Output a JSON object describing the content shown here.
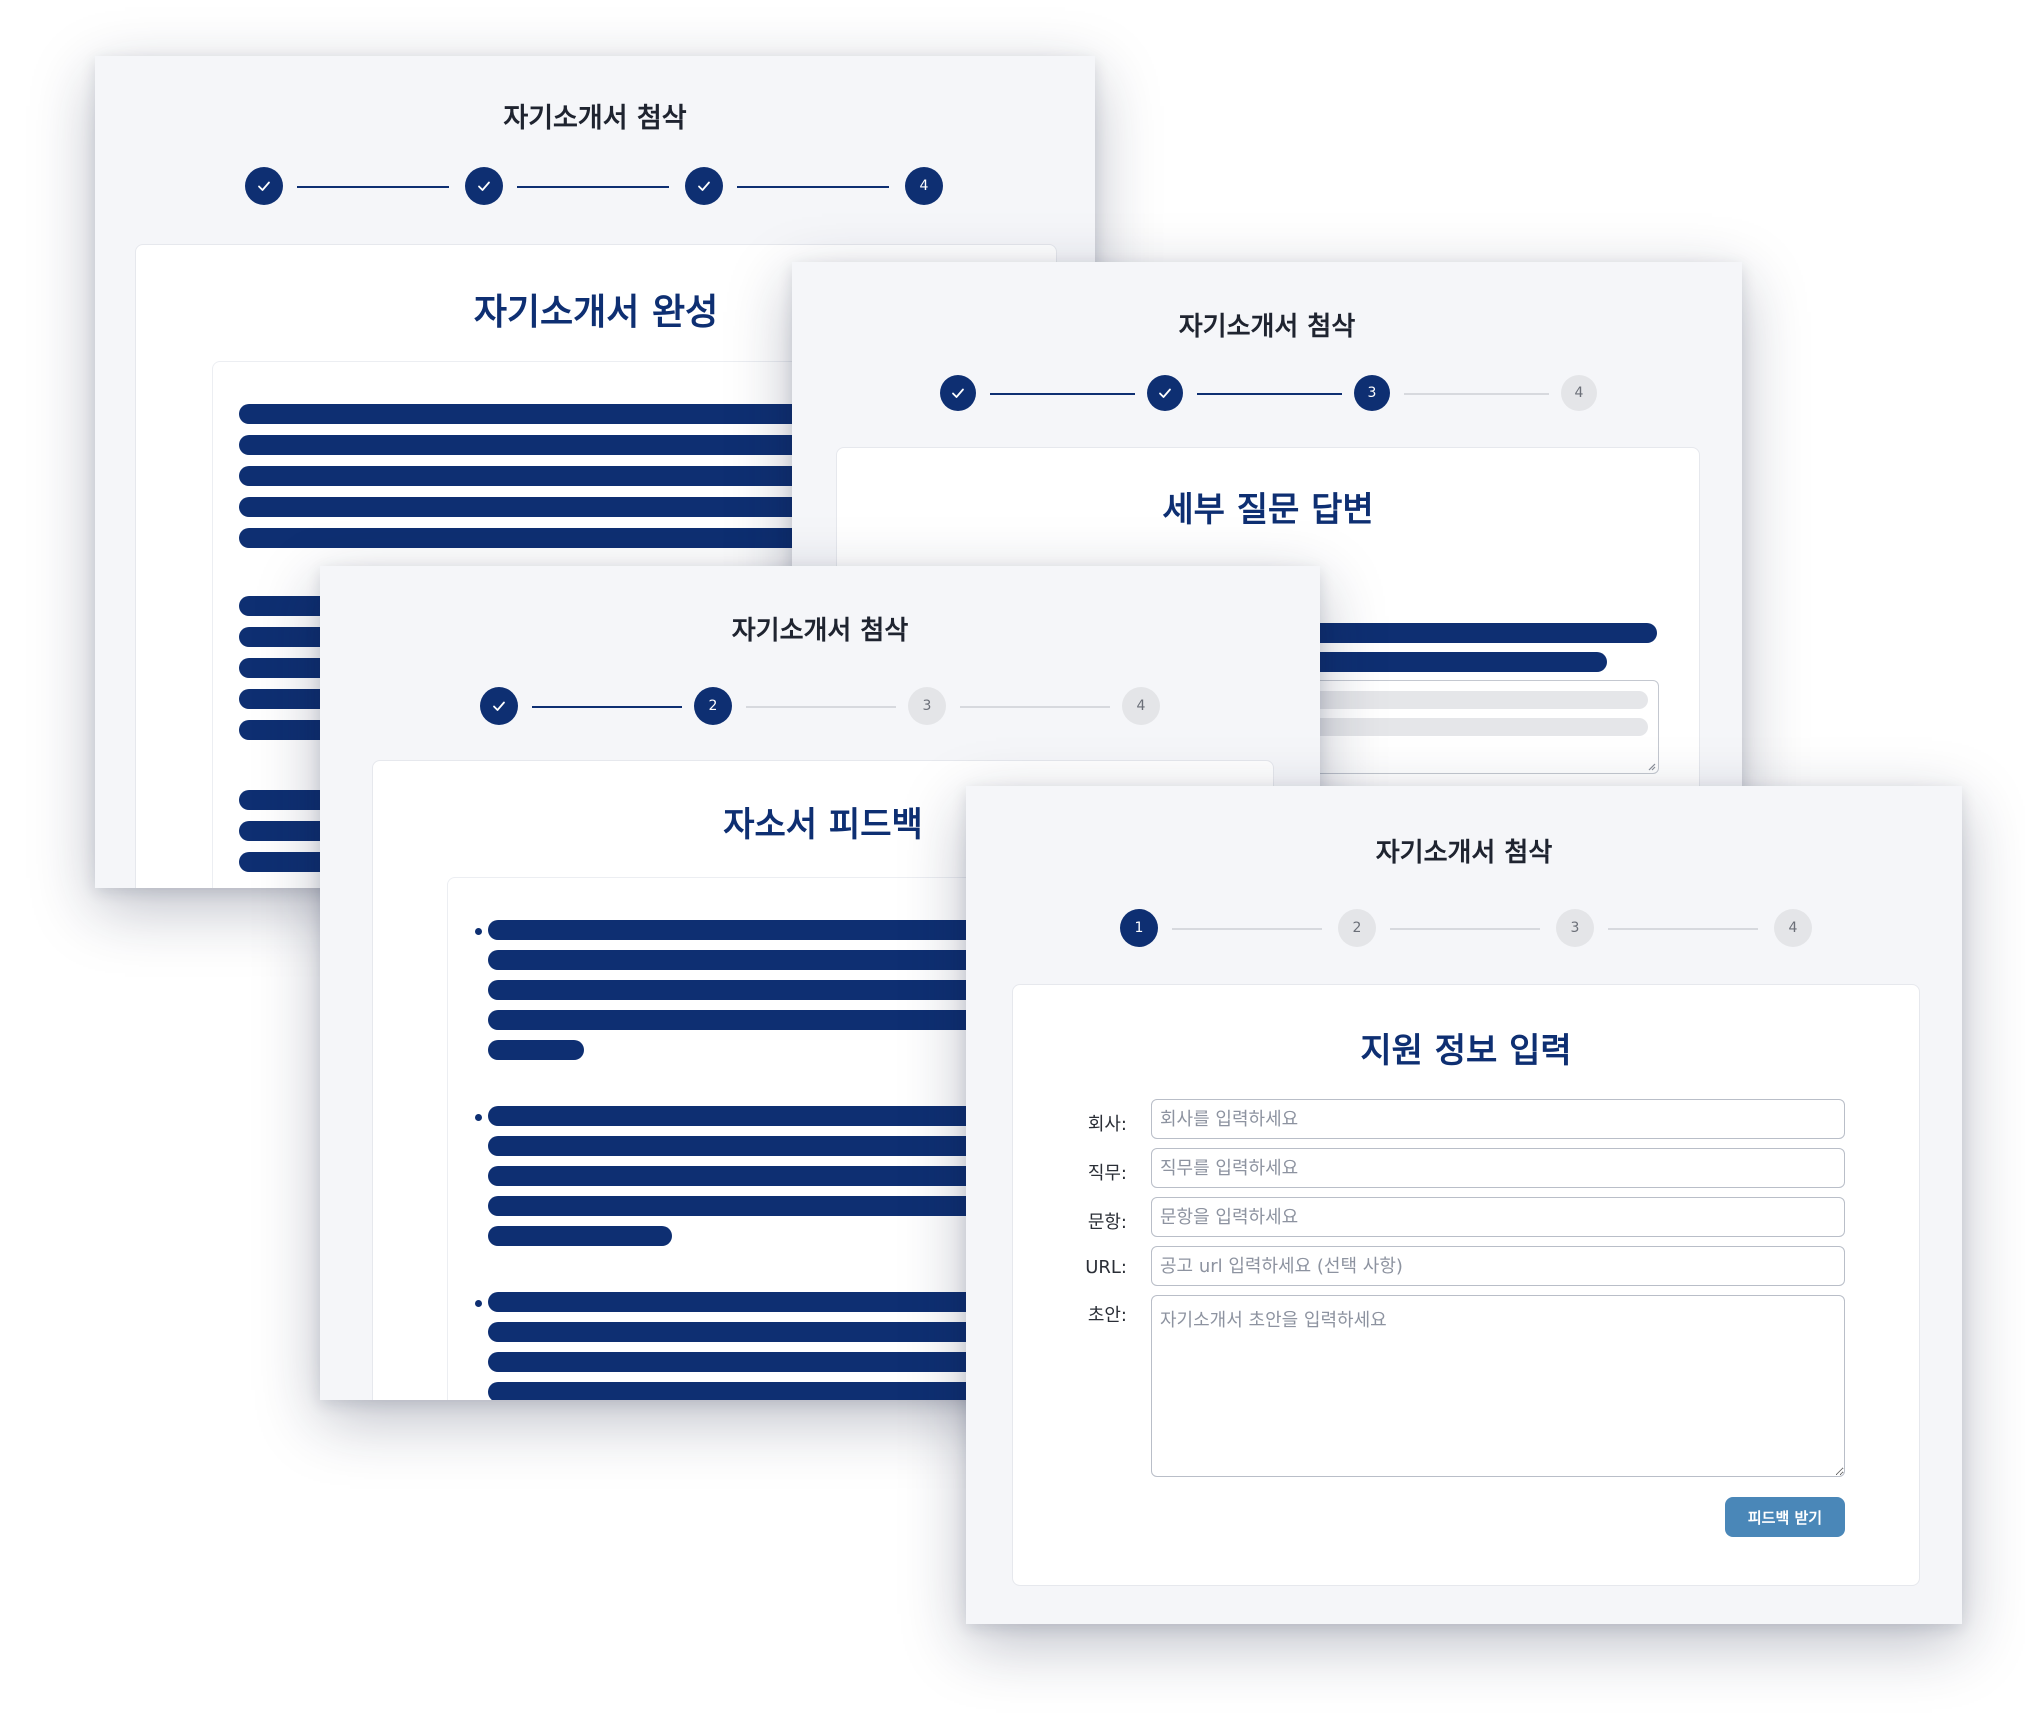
{
  "screens": [
    {
      "app_title": "자기소개서 첨삭",
      "steps": [
        "check",
        "check",
        "check",
        "4"
      ],
      "card_title": "자기소개서 완성"
    },
    {
      "app_title": "자기소개서 첨삭",
      "steps": [
        "check",
        "check",
        "3",
        "4"
      ],
      "card_title": "세부 질문 답변"
    },
    {
      "app_title": "자기소개서 첨삭",
      "steps": [
        "check",
        "2",
        "3",
        "4"
      ],
      "card_title": "자소서 피드백"
    },
    {
      "app_title": "자기소개서 첨삭",
      "steps": [
        "1",
        "2",
        "3",
        "4"
      ],
      "card_title": "지원 정보 입력",
      "form": {
        "company_label": "회사:",
        "company_placeholder": "회사를 입력하세요",
        "job_label": "직무:",
        "job_placeholder": "직무를 입력하세요",
        "question_label": "문항:",
        "question_placeholder": "문항을 입력하세요",
        "url_label": "URL:",
        "url_placeholder": "공고 url 입력하세요 (선택 사항)",
        "draft_label": "초안:",
        "draft_placeholder": "자기소개서 초안을 입력하세요",
        "submit_label": "피드백 받기"
      }
    }
  ],
  "colors": {
    "primary": "#0e2f72",
    "step_inactive": "#e4e5e8",
    "button": "#4a87b8",
    "page_bg": "#f5f6f9"
  }
}
